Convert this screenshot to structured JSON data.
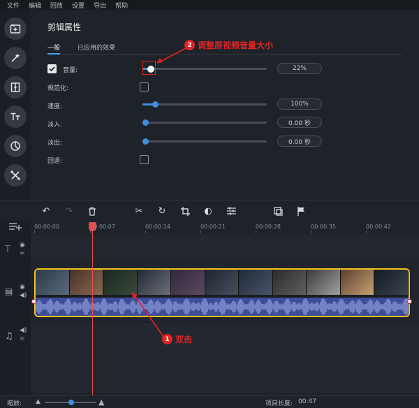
{
  "menu": [
    "文件",
    "编辑",
    "回放",
    "设置",
    "导出",
    "帮助"
  ],
  "sidebar": {
    "tools": [
      {
        "icon": "import-icon"
      },
      {
        "icon": "magic-wand-icon"
      },
      {
        "icon": "transition-icon"
      },
      {
        "icon": "text-icon"
      },
      {
        "icon": "sticker-icon"
      },
      {
        "icon": "more-tools-icon"
      }
    ]
  },
  "properties": {
    "title": "剪辑属性",
    "tabs": [
      "一般",
      "已应用的效果"
    ],
    "rows": {
      "volume_label": "音量:",
      "volume_value": "22%",
      "volume_fraction": 0.07,
      "normalize_label": "规范化:",
      "speed_label": "速度:",
      "speed_value": "100%",
      "speed_fraction": 0.1,
      "fadein_label": "淡入:",
      "fadein_value": "0.00 秒",
      "fadeout_label": "淡出:",
      "fadeout_value": "0.00 秒",
      "reverse_label": "回退:"
    }
  },
  "annotations": {
    "a1_num": "1",
    "a1_text": "双击",
    "a2_num": "2",
    "a2_text": "调整原视频音量大小"
  },
  "toolbar": {
    "undo": "↶",
    "redo": "↷",
    "delete": "🗑",
    "cut": "✂",
    "rotate": "↻",
    "crop": "⌗",
    "color": "◐",
    "settings": "☰"
  },
  "ruler": {
    "labels": [
      "00:00:00",
      "00:00:07",
      "00:00:14",
      "00:00:21",
      "00:00:28",
      "00:00:35",
      "00:00:42"
    ]
  },
  "status": {
    "zoom_label": "缩放:",
    "project_length_label": "项目长度:",
    "project_length_value": "00:47"
  },
  "colors": {
    "accent": "#3f8fe0",
    "annotation": "#e02424",
    "clip_border": "#f2c21a",
    "waveform": "#3e4c9a"
  }
}
